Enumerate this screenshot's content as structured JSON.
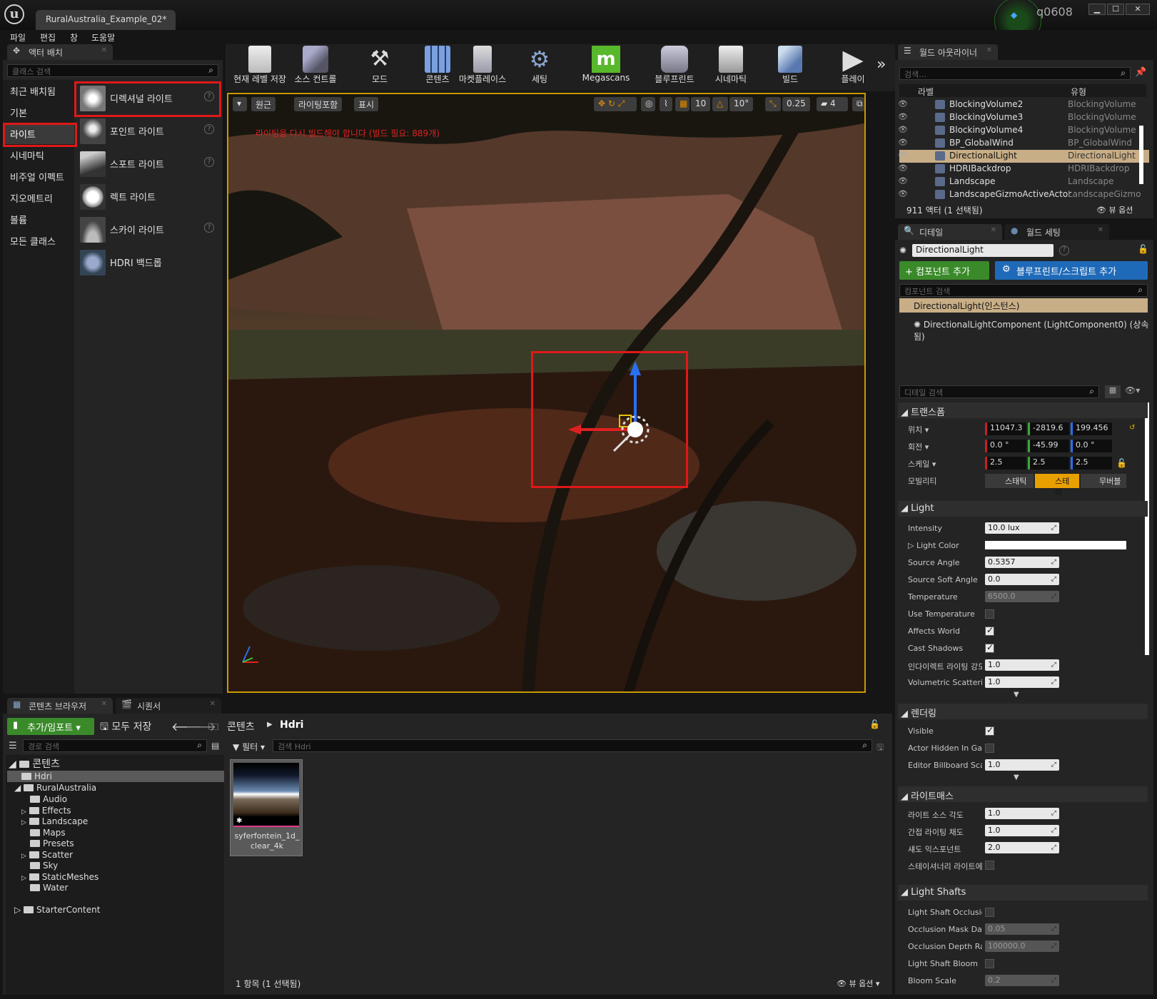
{
  "window": {
    "tab_title": "RuralAustralia_Example_02*",
    "user": "q0608",
    "minimize_label": "▁",
    "maximize_label": "☐",
    "close_label": "✕"
  },
  "menu": [
    "파일",
    "편집",
    "창",
    "도움말"
  ],
  "place_actors": {
    "tab_label": "액터 배치",
    "search_placeholder": "클래스 검색",
    "categories": [
      "최근 배치됨",
      "기본",
      "라이트",
      "시네마틱",
      "비주얼 이펙트",
      "지오메트리",
      "볼륨",
      "모든 클래스"
    ],
    "selected_category": "라이트",
    "items": [
      {
        "label": "디렉셔널 라이트",
        "help": "?"
      },
      {
        "label": "포인트 라이트",
        "help": "?"
      },
      {
        "label": "스포트 라이트",
        "help": "?"
      },
      {
        "label": "렉트 라이트",
        "help": ""
      },
      {
        "label": "스카이 라이트",
        "help": "?"
      },
      {
        "label": "HDRI 백드롭",
        "help": ""
      }
    ]
  },
  "toolbar": {
    "buttons": [
      "현재 레벨 저장",
      "소스 컨트롤",
      "모드",
      "콘텐츠",
      "마켓플레이스",
      "세팅",
      "Megascans",
      "블루프린트",
      "시네마틱",
      "빌드",
      "플레이"
    ],
    "more": "»"
  },
  "viewport": {
    "perspective": "원근",
    "lighting": "라이팅포함",
    "show": "표시",
    "grid_snap": "10",
    "rot_snap": "10°",
    "scale_snap": "0.25",
    "camera_speed": "4",
    "warning": "라이팅을 다시 빌드해야 합니다 (빌드 필요: 889개)"
  },
  "outliner": {
    "tab_label": "월드 아웃라이너",
    "search_placeholder": "검색...",
    "col_label": "라벨",
    "col_type": "유형",
    "rows": [
      {
        "name": "BlockingVolume2",
        "type": "BlockingVolume"
      },
      {
        "name": "BlockingVolume3",
        "type": "BlockingVolume"
      },
      {
        "name": "BlockingVolume4",
        "type": "BlockingVolume"
      },
      {
        "name": "BP_GlobalWind",
        "type": "BP_GlobalWind"
      },
      {
        "name": "DirectionalLight",
        "type": "DirectionalLight"
      },
      {
        "name": "HDRIBackdrop",
        "type": "HDRIBackdrop"
      },
      {
        "name": "Landscape",
        "type": "Landscape"
      },
      {
        "name": "LandscapeGizmoActiveActor",
        "type": "LandscapeGizmo"
      }
    ],
    "selected_row": 4,
    "footer": "911 액터 (1 선택됨)",
    "view_options": "뷰 옵션"
  },
  "details": {
    "tab_details": "디테일",
    "tab_world": "월드 세팅",
    "name_value": "DirectionalLight",
    "add_component": "+ 컴포넌트 추가",
    "add_blueprint": "블루프린트/스크립트 추가",
    "component_search": "컴포넌트 검색",
    "instance": "DirectionalLight(인스턴스)",
    "component": "DirectionalLightComponent (LightComponent0) (상속됨)",
    "details_search": "디테일 검색",
    "transform": {
      "title": "트랜스폼",
      "location_label": "위치",
      "rotation_label": "회전",
      "scale_label": "스케일",
      "mobility_label": "모빌리티",
      "location": [
        "11047.3",
        "-2819.6",
        "199.456"
      ],
      "rotation": [
        "0.0 °",
        "-45.99",
        "0.0 °"
      ],
      "scale": [
        "2.5",
        "2.5",
        "2.5"
      ],
      "mobility": [
        "스태틱",
        "스테이",
        "무버블"
      ]
    },
    "light": {
      "title": "Light",
      "intensity_label": "Intensity",
      "intensity": "10.0 lux",
      "color_label": "Light Color",
      "source_angle_label": "Source Angle",
      "source_angle": "0.5357",
      "source_soft_angle_label": "Source Soft Angle",
      "source_soft_angle": "0.0",
      "temperature_label": "Temperature",
      "temperature": "6500.0",
      "use_temperature_label": "Use Temperature",
      "affects_world_label": "Affects World",
      "cast_shadows_label": "Cast Shadows",
      "indirect_label": "인다이렉트 라이팅 강도",
      "indirect": "1.0",
      "volumetric_label": "Volumetric Scattering",
      "volumetric": "1.0"
    },
    "rendering": {
      "title": "렌더링",
      "visible_label": "Visible",
      "actor_hidden_label": "Actor Hidden In Game",
      "billboard_label": "Editor Billboard Scale",
      "billboard": "1.0"
    },
    "lightmass": {
      "title": "라이트매스",
      "source_angle_label": "라이트 소스 각도",
      "source_angle": "1.0",
      "indirect_sat_label": "간접 라이팅 채도",
      "indirect_sat": "1.0",
      "shadow_exp_label": "섀도 익스포넌트",
      "shadow_exp": "2.0",
      "stationary_label": "스테이셔너리 라이트에"
    },
    "shafts": {
      "title": "Light Shafts",
      "occlusion_label": "Light Shaft Occlusion",
      "mask_label": "Occlusion Mask Darkness",
      "mask": "0.05",
      "depth_label": "Occlusion Depth Range",
      "depth": "100000.0",
      "bloom_label": "Light Shaft Bloom",
      "bloom_scale_label": "Bloom Scale",
      "bloom_scale": "0.2"
    }
  },
  "content_browser": {
    "tab_label": "콘텐츠 브라우저",
    "tab_seq": "시퀀서",
    "add_import": "추가/임포트",
    "save_all": "모두 저장",
    "path_root": "콘텐츠",
    "path_current": "Hdri",
    "path_search": "경로 검색",
    "filter": "필터",
    "asset_search": "검색 Hdri",
    "tree": {
      "root": "콘텐츠",
      "hdri": "Hdri",
      "rural": "RuralAustralia",
      "children": [
        "Audio",
        "Effects",
        "Landscape",
        "Maps",
        "Presets",
        "Scatter",
        "Sky",
        "StaticMeshes",
        "Water"
      ],
      "starter": "StarterContent"
    },
    "asset_name": "syferfontein_1d_clear_4k",
    "footer": "1 항목 (1 선택됨)",
    "view_options": "뷰 옵션"
  }
}
